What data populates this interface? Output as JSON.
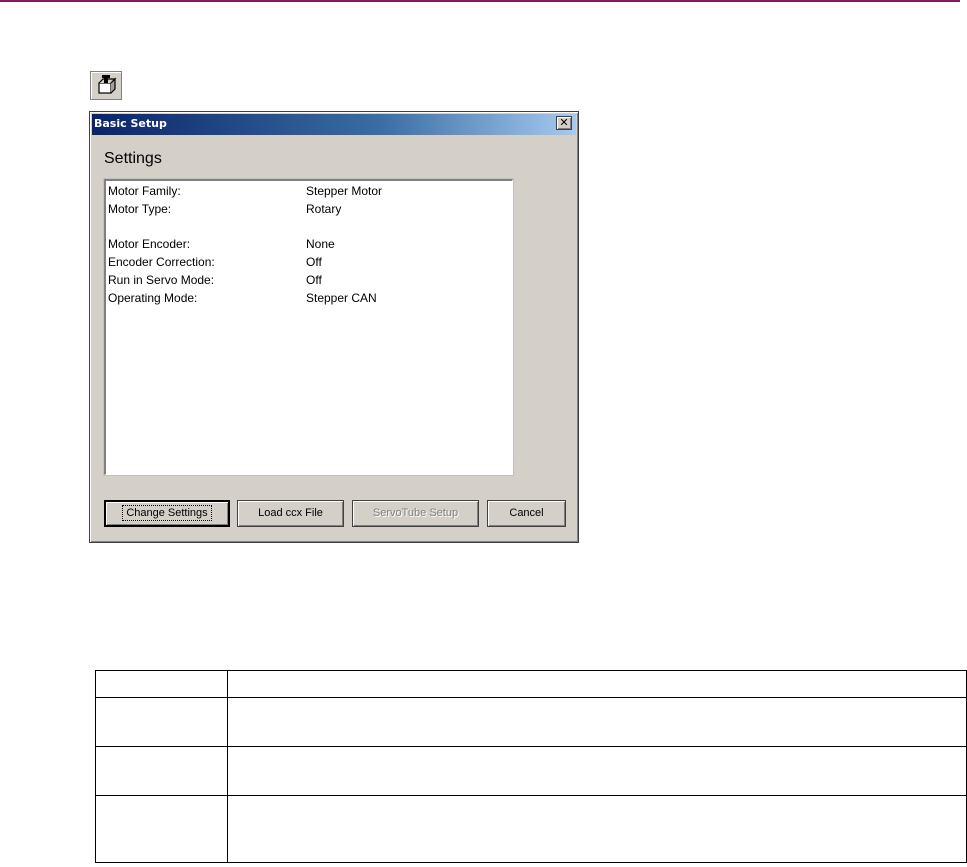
{
  "page": {
    "accent_rule_color": "#7a1f5c"
  },
  "toolbar": {
    "icon": "basic-setup-tool-icon"
  },
  "dialog": {
    "title": "Basic Setup",
    "close_glyph": "✕",
    "heading": "Settings",
    "settings": [
      {
        "label": "Motor Family:",
        "value": "Stepper Motor"
      },
      {
        "label": "Motor Type:",
        "value": "Rotary"
      },
      {
        "label": "Motor Encoder:",
        "value": "None"
      },
      {
        "label": "Encoder Correction:",
        "value": "Off"
      },
      {
        "label": "Run in Servo Mode:",
        "value": "Off"
      },
      {
        "label": "Operating Mode:",
        "value": "Stepper CAN"
      }
    ],
    "buttons": {
      "change_settings": "Change Settings",
      "load_ccx": "Load ccx File",
      "servotube_setup": "ServoTube Setup",
      "cancel": "Cancel"
    },
    "colors": {
      "face": "#d4d0c8",
      "title_start": "#0a246a",
      "title_end": "#a6caf0"
    }
  },
  "doc_table": {
    "rows": 4,
    "columns": 2
  }
}
